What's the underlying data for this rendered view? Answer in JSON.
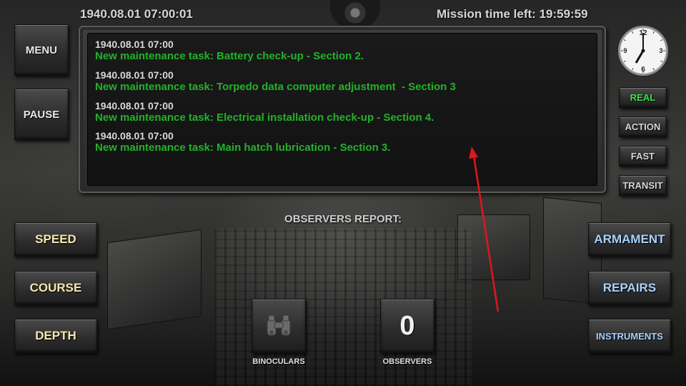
{
  "header": {
    "datetime": "1940.08.01 07:00:01",
    "mission_time_left": "Mission time left: 19:59:59"
  },
  "left_buttons": {
    "menu": "MENU",
    "pause": "PAUSE",
    "speed": "SPEED",
    "course": "COURSE",
    "depth": "DEPTH"
  },
  "log": [
    {
      "time": "1940.08.01 07:00",
      "message": "New maintenance task: Battery check-up - Section 2."
    },
    {
      "time": "1940.08.01 07:00",
      "message": "New maintenance task: Torpedo data computer adjustment  - Section 3"
    },
    {
      "time": "1940.08.01 07:00",
      "message": "New maintenance task: Electrical installation check-up - Section 4."
    },
    {
      "time": "1940.08.01 07:00",
      "message": "New maintenance task: Main hatch lubrication - Section 3."
    }
  ],
  "clock": {
    "numerals": [
      "12",
      "3",
      "6",
      "9"
    ]
  },
  "time_modes": {
    "real": "REAL",
    "action": "ACTION",
    "fast": "FAST",
    "transit": "TRANSIT",
    "active_color": "#3de04a"
  },
  "right_buttons": {
    "armament": "ARMAMENT",
    "repairs": "REPAIRS",
    "instruments": "INSTRUMENTS"
  },
  "observers": {
    "report_label": "OBSERVERS REPORT:",
    "binoculars_label": "BINOCULARS",
    "binoculars_icon": "binoculars-icon",
    "count": "0",
    "observers_label": "OBSERVERS"
  },
  "annotation": {
    "color": "#e0161b"
  }
}
